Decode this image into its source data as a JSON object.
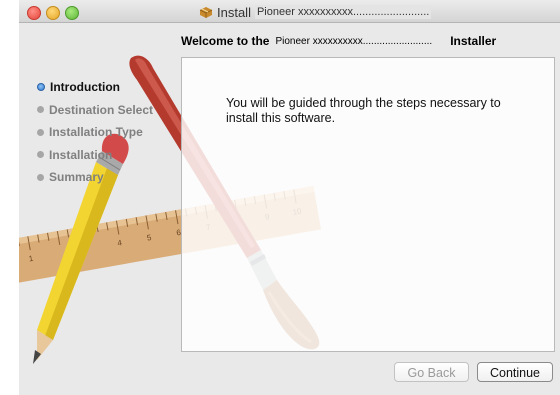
{
  "window": {
    "title": "Install",
    "title_product": "Pioneer xxxxxxxxxx.........................",
    "header": {
      "prefix": "Welcome to the",
      "product": "Pioneer xxxxxxxxxx.........................",
      "suffix": "Installer"
    }
  },
  "sidebar": {
    "steps": [
      {
        "label": "Introduction",
        "active": true
      },
      {
        "label": "Destination Select",
        "active": false
      },
      {
        "label": "Installation Type",
        "active": false
      },
      {
        "label": "Installation",
        "active": false
      },
      {
        "label": "Summary",
        "active": false
      }
    ]
  },
  "content": {
    "message": "You will be guided through the steps necessary to install this software."
  },
  "buttons": {
    "go_back": "Go Back",
    "continue": "Continue"
  },
  "ruler": {
    "numbers": [
      "1",
      "4",
      "5",
      "6",
      "7",
      "8",
      "9",
      "10"
    ]
  },
  "colors": {
    "active_step": "#2f78d0",
    "window_bg": "#e9e9e9"
  }
}
